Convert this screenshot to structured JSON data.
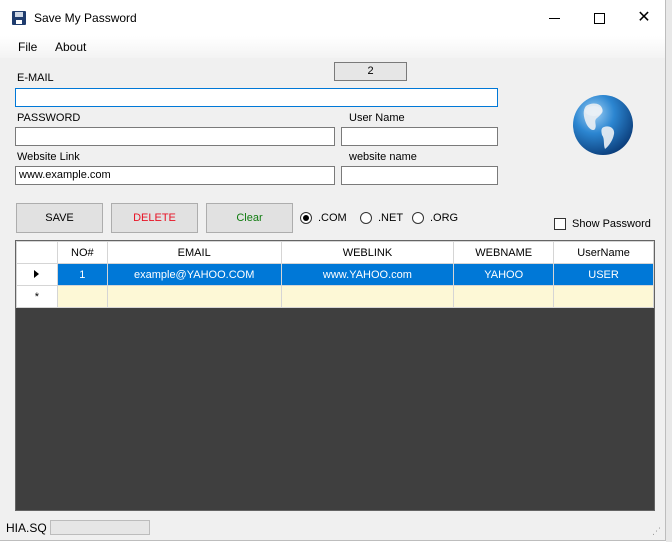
{
  "window": {
    "title": "Save My Password"
  },
  "menu": [
    "File",
    "About"
  ],
  "form": {
    "email_label": "E-MAIL",
    "email_value": "",
    "password_label": "PASSWORD",
    "password_value": "",
    "username_label": "User Name",
    "username_value": "",
    "link_label": "Website Link",
    "link_value": "www.example.com",
    "site_label": "website name",
    "site_value": "",
    "counter": "2"
  },
  "buttons": {
    "save": "SAVE",
    "delete": "DELETE",
    "clear": "Clear"
  },
  "colors": {
    "delete_text": "#e81123",
    "clear_text": "#107c10",
    "selection": "#0078d7",
    "new_row": "#fdf8d6"
  },
  "domains": [
    ".COM",
    ".NET",
    ".ORG"
  ],
  "selected_domain": ".COM",
  "show_password": {
    "label": "Show Password",
    "checked": false
  },
  "grid": {
    "columns": [
      "NO#",
      "EMAIL",
      "WEBLINK",
      "WEBNAME",
      "UserName"
    ],
    "rows": [
      [
        "1",
        "example@YAHOO.COM",
        "www.YAHOO.com",
        "YAHOO",
        "USER"
      ]
    ],
    "new_row_marker": "*"
  },
  "status": {
    "label": "HIA.SQ",
    "progress": 0
  },
  "icons": {
    "app": "floppy-disk-icon",
    "globe": "globe-icon"
  }
}
